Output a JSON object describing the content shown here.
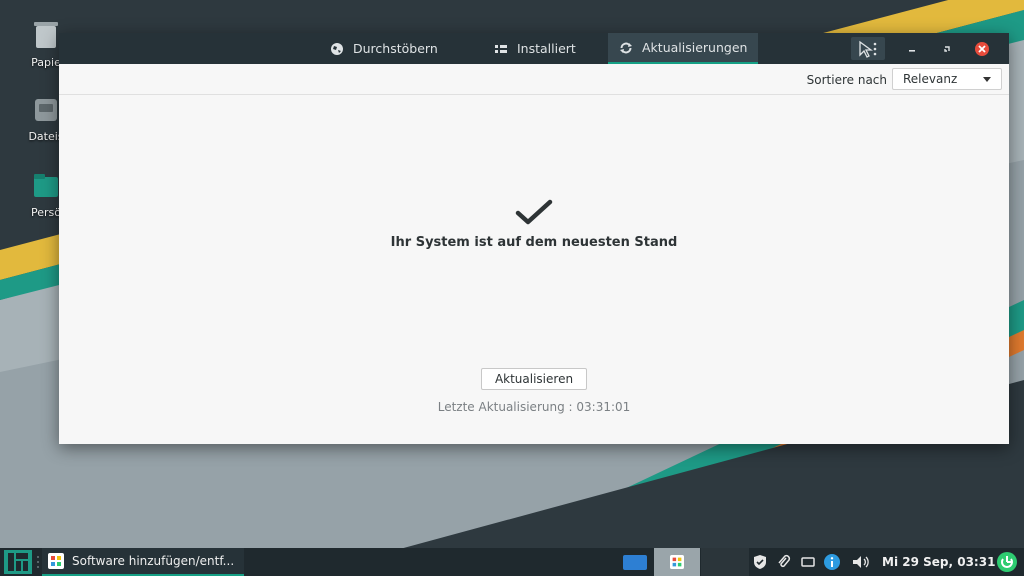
{
  "desktop": {
    "icons": [
      {
        "label": "Papie"
      },
      {
        "label": "Dateis"
      },
      {
        "label": "Persö"
      }
    ]
  },
  "window": {
    "tabs": [
      {
        "label": "Durchstöbern",
        "icon": "globe-icon"
      },
      {
        "label": "Installiert",
        "icon": "list-icon"
      },
      {
        "label": "Aktualisierungen",
        "icon": "refresh-icon",
        "active": true
      }
    ],
    "sort": {
      "label": "Sortiere nach",
      "value": "Relevanz"
    },
    "status_message": "Ihr System ist auf dem neuesten Stand",
    "update_button": "Aktualisieren",
    "last_update": "Letzte Aktualisierung : 03:31:01"
  },
  "taskbar": {
    "task_label": "Software hinzufügen/entf...",
    "clock": "Mi 29 Sep, 03:31"
  },
  "colors": {
    "accent": "#16a085",
    "headerbar": "#263238",
    "window_bg": "#f7f7f7",
    "taskbar": "#1f292e"
  }
}
